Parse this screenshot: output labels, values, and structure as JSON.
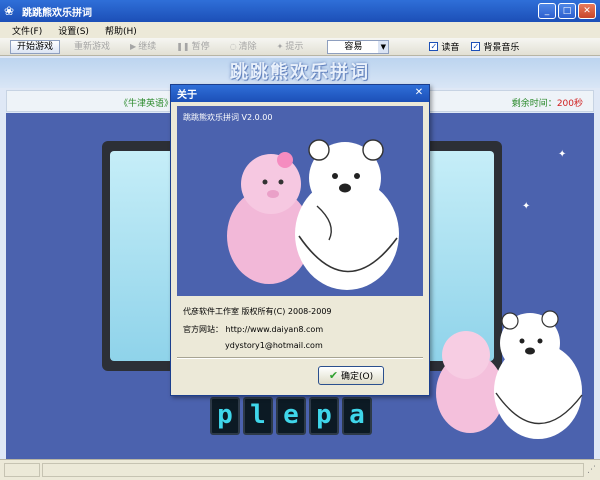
{
  "window": {
    "title": "跳跳熊欢乐拼词"
  },
  "menu": [
    {
      "label": "文件(F)"
    },
    {
      "label": "设置(S)"
    },
    {
      "label": "帮助(H)"
    }
  ],
  "toolbar": {
    "start": "开始游戏",
    "restart": "重新游戏",
    "continue": "继续",
    "pause": "暂停",
    "clear": "清除",
    "hint": "提示",
    "difficulty": "容易",
    "read_aloud": "读音",
    "bg_music": "背景音乐"
  },
  "banner": {
    "logo": "跳跳熊欢乐拼词"
  },
  "info": {
    "left": "《牛津英语》",
    "right_label": "剩余时间：",
    "right_value": "200秒"
  },
  "tiles": [
    "p",
    "l",
    "e",
    "p",
    "a"
  ],
  "dialog": {
    "title": "关于",
    "version": "跳跳熊欢乐拼词  V2.0.00",
    "company": "代彦软件工作室   版权所有(C) 2008-2009",
    "website_label": "官方网站：",
    "website": "http://www.daiyan8.com",
    "email": "ydystory1@hotmail.com",
    "ok": "确定(O)"
  },
  "colors": {
    "stage_bg": "#4b62ae",
    "title_blue": "#1c4fb7",
    "tile_text": "#3fd6ea"
  }
}
